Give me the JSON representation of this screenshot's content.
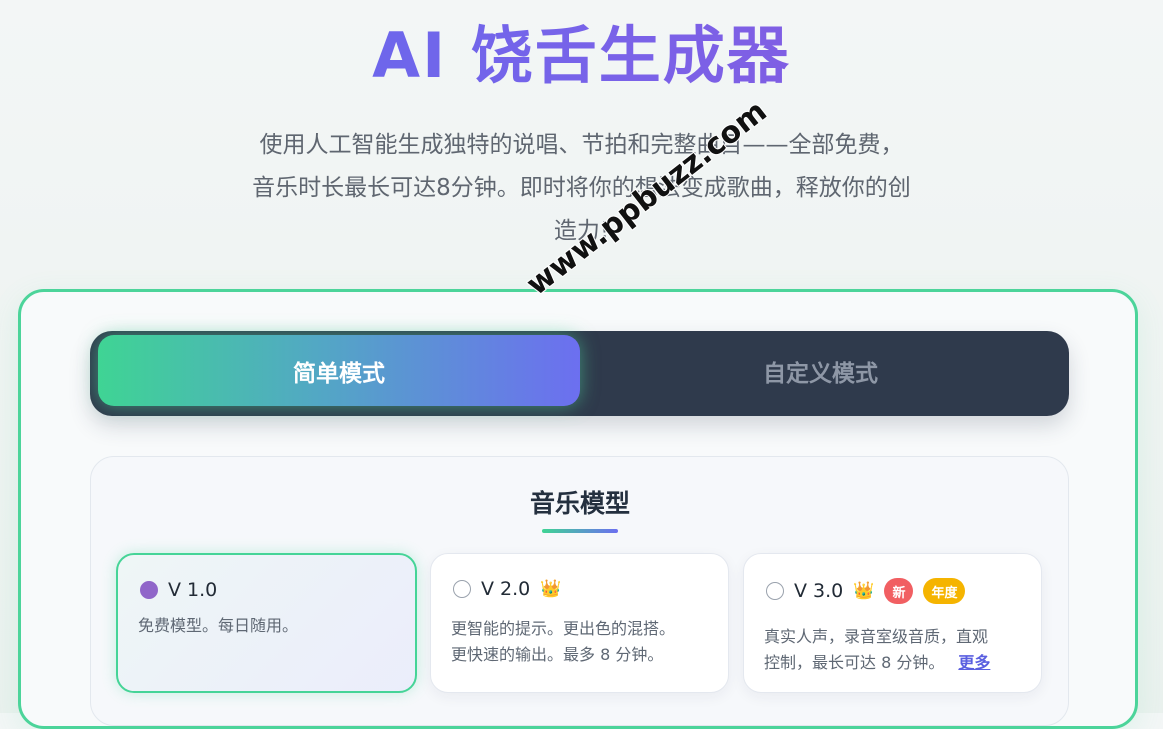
{
  "hero": {
    "title": "AI 饶舌生成器",
    "subtitle_line1": "使用人工智能生成独特的说唱、节拍和完整曲目——全部免费，",
    "subtitle_line2": "音乐时长最长可达8分钟。即时将你的想法变成歌曲，释放你的创",
    "subtitle_line3": "造力!"
  },
  "mode_toggle": {
    "simple_label": "简单模式",
    "custom_label": "自定义模式",
    "active": "simple"
  },
  "model_section": {
    "title": "音乐模型",
    "cards": [
      {
        "version": "V 1.0",
        "selected": true,
        "desc_line1": "免费模型。每日随用。"
      },
      {
        "version": "V 2.0",
        "selected": false,
        "crown_icon": "crown-icon",
        "desc_line1": "更智能的提示。更出色的混搭。",
        "desc_line2": "更快速的输出。最多 8 分钟。"
      },
      {
        "version": "V 3.0",
        "selected": false,
        "crown_icon": "crown-icon",
        "badge_new": "新",
        "badge_year": "年度",
        "desc_line1": "真实人声，录音室级音质，直观",
        "desc_line2": "控制，最长可达 8 分钟。",
        "more_label": "更多"
      }
    ]
  },
  "watermark": "www.ppbuzz.com",
  "colors": {
    "accent_green": "#4cd49a",
    "accent_purple": "#6c6ff0",
    "toggle_dark": "#2f3a4c",
    "badge_red": "#f15f62",
    "badge_yellow": "#f5b400"
  }
}
